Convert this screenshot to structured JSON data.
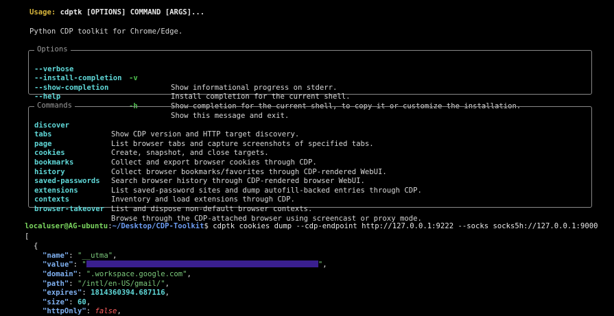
{
  "usage": {
    "label": "Usage:",
    "command": "cdptk [OPTIONS] COMMAND [ARGS]..."
  },
  "description": "Python CDP toolkit for Chrome/Edge.",
  "options": {
    "title": "Options",
    "items": [
      {
        "name": "--verbose",
        "short": "-v",
        "desc": "Show informational progress on stderr."
      },
      {
        "name": "--install-completion",
        "short": "",
        "desc": "Install completion for the current shell."
      },
      {
        "name": "--show-completion",
        "short": "",
        "desc": "Show completion for the current shell, to copy it or customize the installation."
      },
      {
        "name": "--help",
        "short": "-h",
        "desc": "Show this message and exit."
      }
    ]
  },
  "commands": {
    "title": "Commands",
    "items": [
      {
        "name": "discover",
        "desc": "Show CDP version and HTTP target discovery."
      },
      {
        "name": "tabs",
        "desc": "List browser tabs and capture screenshots of specified tabs."
      },
      {
        "name": "page",
        "desc": "Create, snapshot, and close targets."
      },
      {
        "name": "cookies",
        "desc": "Collect and export browser cookies through CDP."
      },
      {
        "name": "bookmarks",
        "desc": "Collect browser bookmarks/favorites through CDP-rendered WebUI."
      },
      {
        "name": "history",
        "desc": "Search browser history through CDP-rendered browser WebUI."
      },
      {
        "name": "saved-passwords",
        "desc": "List saved-password sites and dump autofill-backed entries through CDP."
      },
      {
        "name": "extensions",
        "desc": "Inventory and load extensions through CDP."
      },
      {
        "name": "contexts",
        "desc": "List and dispose non-default browser contexts."
      },
      {
        "name": "browser-takeover",
        "desc": "Browse through the CDP-attached browser using screencast or proxy mode."
      }
    ]
  },
  "prompt": {
    "user_host": "localuser@AG-ubuntu",
    "colon": ":",
    "path": "~/Desktop/CDP-Toolkit",
    "dollar": "$",
    "command": " cdptk cookies dump --cdp-endpoint http://127.0.0.1:9222 --socks socks5h://127.0.0.1:9000"
  },
  "json_output": {
    "open_bracket": "[",
    "open_brace": "{",
    "name_key": "\"name\"",
    "name_val": "\"__utma\"",
    "value_key": "\"value\"",
    "value_open": "\"",
    "value_close": "\"",
    "domain_key": "\"domain\"",
    "domain_val": "\".workspace.google.com\"",
    "path_key": "\"path\"",
    "path_val": "\"/intl/en-US/gmail/\"",
    "expires_key": "\"expires\"",
    "expires_val": "1814360394.687116",
    "size_key": "\"size\"",
    "size_val": "60",
    "httponly_key": "\"httpOnly\"",
    "httponly_val": "false"
  },
  "colors": {
    "background": "#000000",
    "usage_label": "#d7b53b",
    "option_name": "#5fd7d7",
    "option_short": "#4fbf4f",
    "prompt_user": "#7bd65f",
    "prompt_path": "#6c9bf0",
    "json_key": "#7fb0f0",
    "json_string": "#7cc97c",
    "json_bool": "#ff5f5f",
    "redaction": "#3a1f8f"
  }
}
